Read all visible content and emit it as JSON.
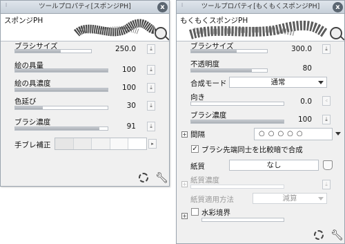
{
  "left_panel": {
    "title": "ツールプロパティ[スポンジPH]",
    "preview_name": "スポンジPH",
    "close": "x",
    "params": [
      {
        "label": "ブラシサイズ",
        "value": "250.0",
        "level": 0.6
      },
      {
        "label": "絵の具量",
        "value": "100",
        "level": 1.0
      },
      {
        "label": "絵の具濃度",
        "value": "100",
        "level": 1.0
      },
      {
        "label": "色延び",
        "value": "30",
        "level": 0.3
      },
      {
        "label": "ブラシ濃度",
        "value": "91",
        "level": 0.91
      }
    ],
    "stabilizer_label": "手ブレ補正"
  },
  "right_panel": {
    "title": "ツールプロパティ[もくもくスポンジPH]",
    "preview_name": "もくもくスポンジPH",
    "close": "x",
    "brush_size": {
      "label": "ブラシサイズ",
      "value": "300.0",
      "level": 0.6
    },
    "opacity": {
      "label": "不透明度",
      "value": "80",
      "level": 0.8
    },
    "blend_mode": {
      "label": "合成モード",
      "value": "通常"
    },
    "direction": {
      "label": "向き",
      "value": "0.0",
      "level": 0.0
    },
    "brush_density": {
      "label": "ブラシ濃度",
      "value": "100",
      "level": 1.0
    },
    "interval": {
      "label": "間隔",
      "dots": "○○○○○",
      "selected": "○○○"
    },
    "combine_checkbox": {
      "label": "ブラシ先端同士を比較暗で合成",
      "checked": true,
      "mark": "✓"
    },
    "paper": {
      "label": "紙質",
      "value": "なし"
    },
    "paper_density": {
      "label": "紙質濃度"
    },
    "paper_method": {
      "label": "紙質適用方法",
      "value": "減算"
    },
    "watercolor_edge": {
      "label": "水彩境界"
    }
  }
}
